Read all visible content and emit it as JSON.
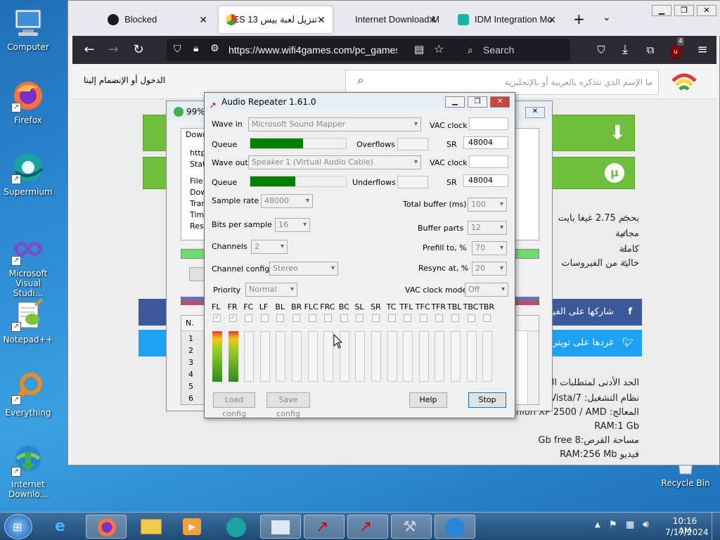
{
  "desktop": {
    "icons": [
      {
        "label": "Computer"
      },
      {
        "label": "Firefox"
      },
      {
        "label": "Supermium"
      },
      {
        "label": "Microsoft Visual Studi..."
      },
      {
        "label": "Notepad++"
      },
      {
        "label": "Everything"
      },
      {
        "label": "Internet Downlo..."
      },
      {
        "label": "Recycle Bin"
      }
    ]
  },
  "browser": {
    "tabs": [
      {
        "label": "Blocked",
        "icon": "github-icon"
      },
      {
        "label": "تنزيل لعبة بيس 13 PES",
        "icon": "wifi4games-icon",
        "active": true
      },
      {
        "label": "Internet Download M",
        "icon": "none"
      },
      {
        "label": "IDM Integration Mo",
        "icon": "idm-icon"
      }
    ],
    "url": "https://www.wifi4games.com/pc_games/p",
    "search_placeholder": "Search",
    "extension_badge": "4"
  },
  "site": {
    "login_link": "الدخول أو الإنضمام إلينا",
    "search_placeholder": "ما الإسم الذي تتذكره بالعربية أو بالإنجليزية",
    "features": [
      "بحجم 2.75 غيغا بايت",
      "مجانية",
      "كاملة",
      "خالية من الفيروسات"
    ],
    "share_facebook": "شاركها على الفيسبوك",
    "share_twitter": "غردها على تويتر",
    "requirements_title": "الحد الأدنى لمتطلبات التشغيل",
    "req_os": "نظام التشغيل: XP/Vista/7",
    "req_cpu": "المعالج: Athlon XP 2500 / AMD",
    "req_ram": "RAM:1 Gb",
    "req_disk": "مساحة القرص:8 Gb free",
    "req_video": "فيديو RAM:256 Mb"
  },
  "idm_window": {
    "title": "99%",
    "tab_label": "Down",
    "field_labels": [
      "http",
      "Stat",
      "File s",
      "Dow",
      "Tran",
      "Time",
      "Resu"
    ],
    "list_header": "N.",
    "list_rows": [
      "1",
      "2",
      "3",
      "4",
      "5",
      "6"
    ]
  },
  "audio_repeater": {
    "title": "Audio Repeater 1.61.0",
    "wave_in_label": "Wave in",
    "wave_in_value": "Microsoft Sound Mapper",
    "wave_out_label": "Wave out",
    "wave_out_value": "Speaker 1 (Virtual Audio Cable)",
    "vac_clock_label": "VAC clock",
    "queue_label": "Queue",
    "overflows_label": "Overflows",
    "underflows_label": "Underflows",
    "sr_label": "SR",
    "sr_in_value": "48004",
    "sr_out_value": "48004",
    "queue_in_level": 0.55,
    "queue_out_level": 0.47,
    "sample_rate_label": "Sample rate",
    "sample_rate_value": "48000",
    "bits_label": "Bits per sample",
    "bits_value": "16",
    "channels_label": "Channels",
    "channels_value": "2",
    "channel_config_label": "Channel config",
    "channel_config_value": "Stereo",
    "priority_label": "Priority",
    "priority_value": "Normal",
    "total_buffer_label": "Total buffer (ms)",
    "total_buffer_value": "100",
    "buffer_parts_label": "Buffer parts",
    "buffer_parts_value": "12",
    "prefill_label": "Prefill to, %",
    "prefill_value": "70",
    "resync_label": "Resync at, %",
    "resync_value": "20",
    "vac_clock_mode_label": "VAC clock mode",
    "vac_clock_mode_value": "Off",
    "channels_list": [
      "FL",
      "FR",
      "FC",
      "LF",
      "BL",
      "BR",
      "FLC",
      "FRC",
      "BC",
      "SL",
      "SR",
      "TC",
      "TFL",
      "TFC",
      "TFR",
      "TBL",
      "TBC",
      "TBR"
    ],
    "checked_channels": [
      "FL",
      "FR"
    ],
    "load_config": "Load config",
    "save_config": "Save config",
    "help": "Help",
    "stop": "Stop"
  },
  "taskbar": {
    "time": "10:16 AM",
    "date": "7/17/2024"
  }
}
